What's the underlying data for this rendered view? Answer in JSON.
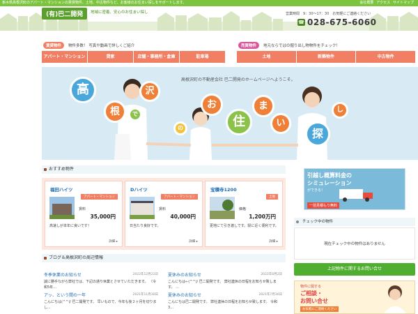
{
  "topbar": {
    "tagline": "栃木県高根沢町のアパート・マンションの賃貸物件、土地、中古物件など、お客様のお住まい探しをサポートします。",
    "links": [
      "会社概要",
      "アクセス",
      "サイトマップ"
    ]
  },
  "header": {
    "logo": "(有)巴二開発",
    "tagline": "地域に密着、安心のお住まい探し",
    "hours": "営業時間　9：30～17：30　お気軽にご連絡ください",
    "phone": "028-675-6060"
  },
  "rent": {
    "badge": "賃貸物件",
    "text": "物件多数！ 写真や動画で詳しくご紹介",
    "nav": [
      "アパート・マンション",
      "貸家",
      "店舗・事務所・倉庫",
      "駐車場"
    ]
  },
  "sale": {
    "badge": "売買物件",
    "text": "地元ならではの掘り出し物物件をチェック！",
    "nav": [
      "土地",
      "新築物件",
      "中古物件"
    ]
  },
  "hero": {
    "welcome": "高根沢町の不動産会社 巴二開発のホームページへようこそ。",
    "chars": [
      "高",
      "沢",
      "根",
      "で",
      "の",
      "お",
      "住",
      "ま",
      "い",
      "探",
      "し"
    ]
  },
  "recommended": {
    "heading": "おすすめ物件",
    "cards": [
      {
        "title": "福田ハイツ",
        "type": "アパート・マンション",
        "price_label": "賃料",
        "price": "35,000円",
        "desc": "高速しが本年に良いです！",
        "detail": "詳細 ▸"
      },
      {
        "title": "Dハイツ",
        "type": "アパート・マンション",
        "price_label": "賃料",
        "price": "40,000円",
        "desc": "日当たり良好です。",
        "detail": "詳細 ▸"
      },
      {
        "title": "宝積寺1200",
        "type": "土地",
        "price_label": "価格",
        "price": "1,200万円",
        "desc": "更地にて引き渡しです。駅に近く便利です。",
        "detail": "詳細 ▸"
      }
    ]
  },
  "blog": {
    "heading": "ブログ＆高根沢町の周辺情報",
    "items": [
      {
        "title": "冬季休業のお知らせ",
        "date": "2022年12月22日",
        "text": "誠に勝手ながら弊社では、下記の通り休業とさせていただきます。 〈令和5年..."
      },
      {
        "title": "夏休みのお知らせ",
        "date": "2022年8月2日",
        "text": "こんにちは←(^^)/ 巴二開発です。 弊社連休の日程をお知らせ致します。 ..."
      },
      {
        "title": "アッ、という間の一年",
        "date": "2021年11月30日",
        "text": "こんにちは(^^)/ 巴二開発です。 早いもので、今年も後２ヶ月を切りまし..."
      },
      {
        "title": "夏休みのお知らせ",
        "date": "2021年7月30日",
        "text": "こんにちは巴二開発です。 弊社連休の日程をお知らせ致します。 令和3..."
      }
    ]
  },
  "side": {
    "ad1": {
      "line1": "引越し概算料金の",
      "line2": "シミュレーション",
      "line3": "ができる！",
      "line4": "一括見積もり無料"
    },
    "check_heading": "チェック中の物件",
    "check_empty": "現在チェック中の物件はありません",
    "inquiry": "上記物件に関するお問い合せ",
    "ad2": {
      "line1": "物件に関する",
      "line2": "ご相談・",
      "line3": "お問い合せ",
      "line4": "お気軽にご連絡ください"
    }
  },
  "colors": {
    "green": "#7cc43e",
    "coral": "#f07f63",
    "blue": "#1a6bb5"
  }
}
